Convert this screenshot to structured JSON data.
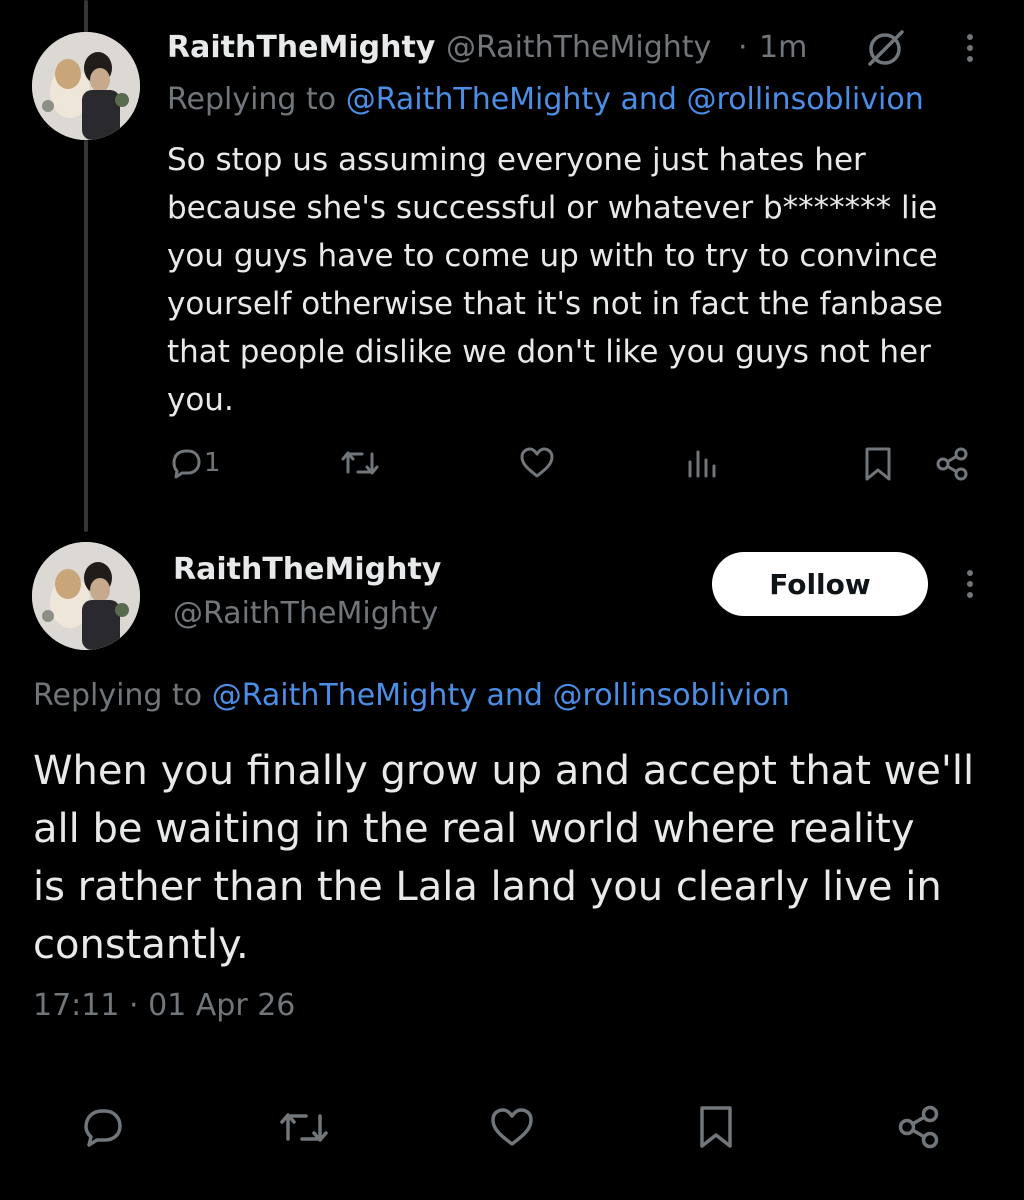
{
  "reply_tweet": {
    "display_name": "RaithTheMighty",
    "handle": "@RaithTheMighty",
    "separator": "·",
    "time_ago": "1m",
    "replying_label": "Replying to",
    "replying_user1": "@RaithTheMighty",
    "replying_and": "and",
    "replying_user2": "@rollinsoblivion",
    "text": "So stop us assuming everyone just hates her\nbecause she's successful or whatever b******* lie\nyou guys have to come up with to try to convince\nyourself otherwise that it's not in fact the fanbase\nthat people dislike we don't like you guys not her\nyou.",
    "reply_count": "1",
    "icons": [
      "reply-icon",
      "retweet-icon",
      "like-icon",
      "views-icon",
      "bookmark-icon",
      "share-icon",
      "grok-icon",
      "more-icon"
    ]
  },
  "main_tweet": {
    "display_name": "RaithTheMighty",
    "handle": "@RaithTheMighty",
    "follow_label": "Follow",
    "replying_label": "Replying to",
    "replying_user1": "@RaithTheMighty",
    "replying_and": "and",
    "replying_user2": "@rollinsoblivion",
    "text": "When you finally grow up and accept that we'll\nall be waiting in the real world where reality\nis rather than the Lala land you clearly live in\nconstantly.",
    "timestamp": "17:11 · 01 Apr 26",
    "icons": [
      "reply-icon",
      "retweet-icon",
      "like-icon",
      "bookmark-icon",
      "share-icon",
      "more-icon"
    ]
  },
  "colors": {
    "background": "#000000",
    "text": "#e7e9ea",
    "muted": "#71767b",
    "link": "#4a8ee6",
    "follow_bg": "#ffffff"
  }
}
